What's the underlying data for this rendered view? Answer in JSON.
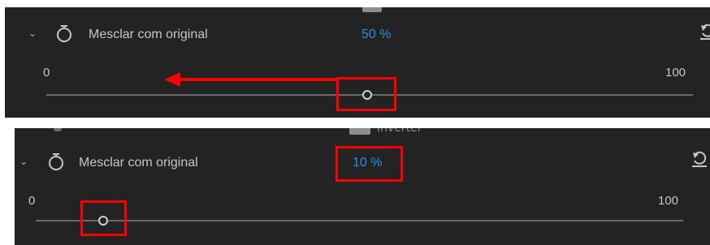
{
  "panels": [
    {
      "property_label": "Mesclar com original",
      "value_text": "50 %",
      "slider": {
        "min_label": "0",
        "max_label": "100",
        "value_percent": 50
      },
      "icons": [
        "chevron-down-icon",
        "stopwatch-icon",
        "reset-icon"
      ],
      "annotations": [
        "knob-highlight-box",
        "drag-left-arrow"
      ]
    },
    {
      "cut_text": "Inverter",
      "property_label": "Mesclar com original",
      "value_text": "10 %",
      "slider": {
        "min_label": "0",
        "max_label": "100",
        "value_percent": 10
      },
      "icons": [
        "chevron-down-icon",
        "stopwatch-icon",
        "reset-icon"
      ],
      "annotations": [
        "value-highlight-box",
        "knob-highlight-box"
      ]
    }
  ],
  "colors": {
    "panel_bg": "#232323",
    "label": "#c6c6c6",
    "value_blue": "#2d8ceb",
    "annotation_red": "#ff0000",
    "track": "#6a6a6a"
  }
}
